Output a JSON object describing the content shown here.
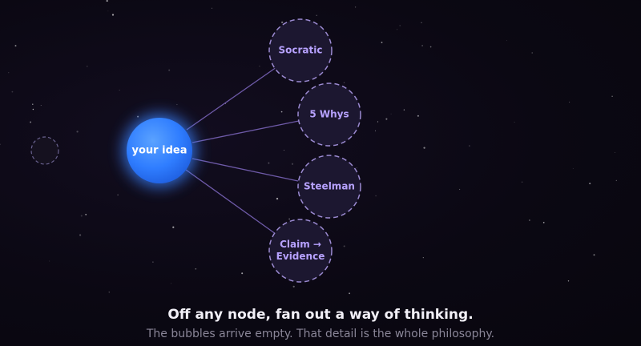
{
  "diagram": {
    "center": {
      "label": "your idea"
    },
    "methods": [
      {
        "label": "Socratic"
      },
      {
        "label": "5 Whys"
      },
      {
        "label": "Steelman"
      },
      {
        "label": "Claim → Evidence"
      }
    ],
    "colors": {
      "center_fill": "#2f7dff",
      "center_glow": "#3b82ff",
      "connector": "#6e5aa8",
      "left_connector": "#7c5cd6",
      "bubble_stroke": "#9b8ad1",
      "bubble_fill": "#1c1730",
      "method_text": "#b7a2ff",
      "background": "#0b0813"
    }
  },
  "caption": {
    "title": "Off any node, fan out a way of thinking.",
    "subtitle": "The bubbles arrive empty. That detail is the whole philosophy."
  }
}
